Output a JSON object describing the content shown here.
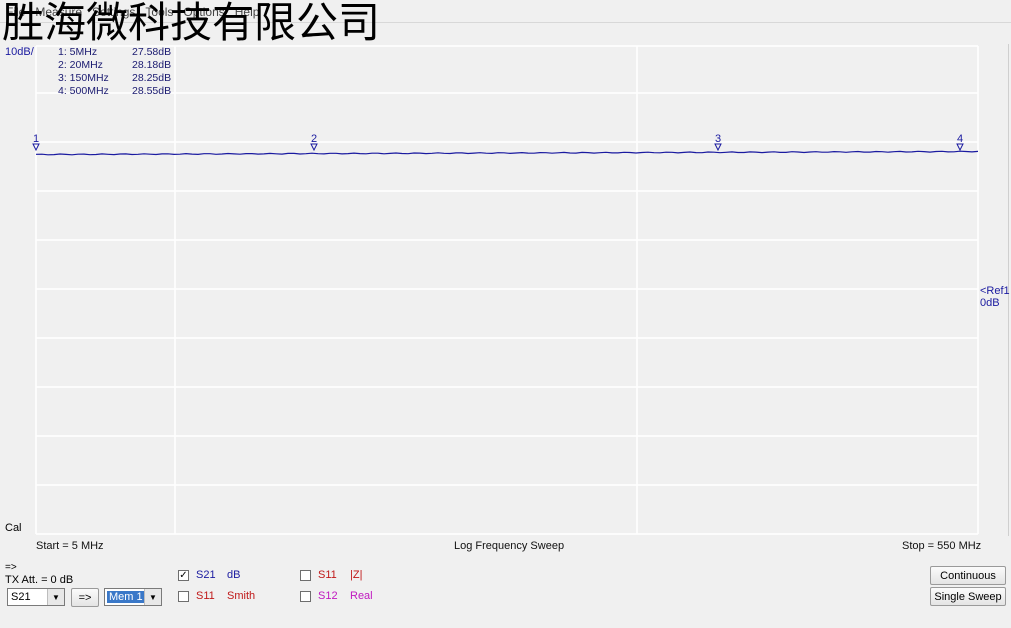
{
  "watermark": "胜海微科技有限公司",
  "menu": [
    "File",
    "Measure",
    "Settings",
    "Tools",
    "Options",
    "Help"
  ],
  "scale": "10dB/",
  "markers": [
    {
      "freq": "1: 5MHz",
      "value": "27.58dB"
    },
    {
      "freq": "2: 20MHz",
      "value": "28.18dB"
    },
    {
      "freq": "3: 150MHz",
      "value": "28.25dB"
    },
    {
      "freq": "4: 500MHz",
      "value": "28.55dB"
    }
  ],
  "marker_tags": [
    "1",
    "2",
    "3",
    "4"
  ],
  "ref": {
    "line1": "<Ref1",
    "line2": "0dB"
  },
  "cal": "Cal",
  "status": {
    "start": "Start = 5 MHz",
    "mode": "Log Frequency Sweep",
    "stop": "Stop = 550 MHz"
  },
  "controls": {
    "arrow": "=>",
    "tx_att": "TX Att.  = 0 dB",
    "param_select": "S21",
    "transfer_button": "=>",
    "memory_select": "Mem 1",
    "continuous_button": "Continuous",
    "single_sweep_button": "Single Sweep"
  },
  "traces": [
    {
      "param": "S21",
      "format": "dB",
      "checked": true,
      "param_color": "#1a1aa0",
      "format_color": "#1a1aa0"
    },
    {
      "param": "S11",
      "format": "Smith",
      "checked": false,
      "param_color": "#c01818",
      "format_color": "#c01818"
    },
    {
      "param": "S11",
      "format": "|Z|",
      "checked": false,
      "param_color": "#c01818",
      "format_color": "#c01818"
    },
    {
      "param": "S12",
      "format": "Real",
      "checked": false,
      "param_color": "#c018c0",
      "format_color": "#c018c0"
    }
  ],
  "colors": {
    "trace": "#1a1aa0",
    "grid": "#ffffff",
    "background": "#f0f0f0"
  }
}
